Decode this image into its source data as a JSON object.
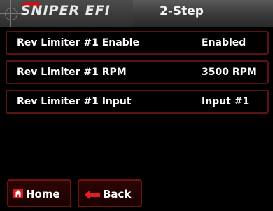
{
  "header": {
    "logo_text": "SNIPER EFI",
    "title": "2-Step"
  },
  "settings": [
    {
      "label": "Rev Limiter #1 Enable",
      "value": "Enabled"
    },
    {
      "label": "Rev Limiter #1 RPM",
      "value": "3500 RPM"
    },
    {
      "label": "Rev Limiter #1 Input",
      "value": "Input #1"
    }
  ],
  "nav": {
    "home_label": "Home",
    "back_label": "Back"
  },
  "colors": {
    "row_border": "#5b1414",
    "button_border": "#6a1414",
    "icon_red": "#d81b1b"
  }
}
